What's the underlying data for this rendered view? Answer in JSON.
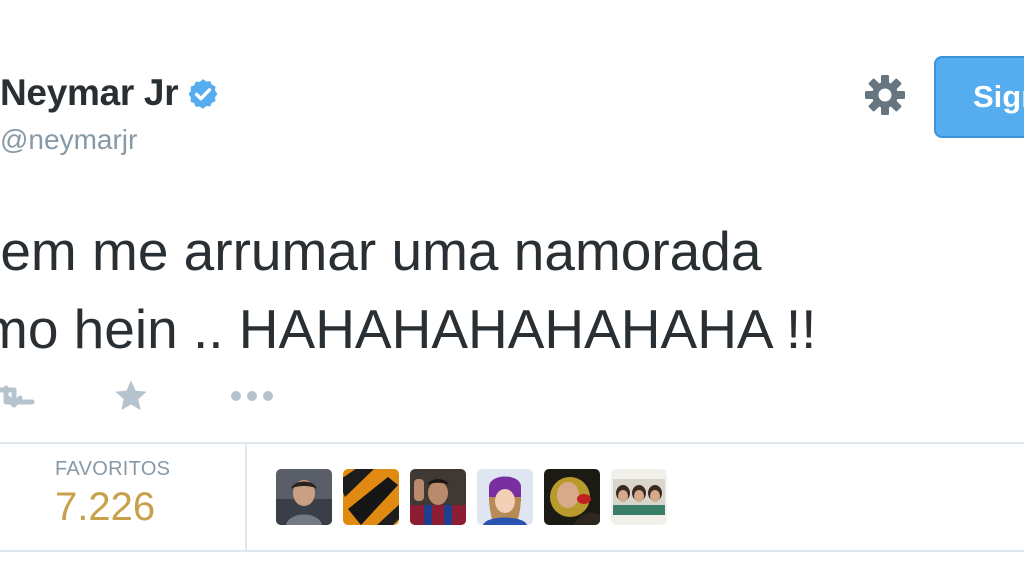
{
  "header": {
    "display_name": "Neymar Jr",
    "handle": "@neymarjr",
    "follow_button_label": "Sign"
  },
  "tweet": {
    "lines": [
      "rem me arrumar uma namorada",
      "mo hein .. HAHAHAHAHAHAHA !!"
    ]
  },
  "actions": {
    "icons": [
      "retweet-icon",
      "star-icon",
      "more-icon"
    ]
  },
  "stats": {
    "favorites_label": "FAVORITOS",
    "favorites_count": "7.226"
  },
  "colors": {
    "text": "#292f33",
    "muted": "#8899a6",
    "accent_blue": "#55acee",
    "verified_blue": "#55acee",
    "favorites_count": "#c8a04a",
    "action_icon": "#b5c3cf",
    "divider": "#e1e8ed"
  }
}
